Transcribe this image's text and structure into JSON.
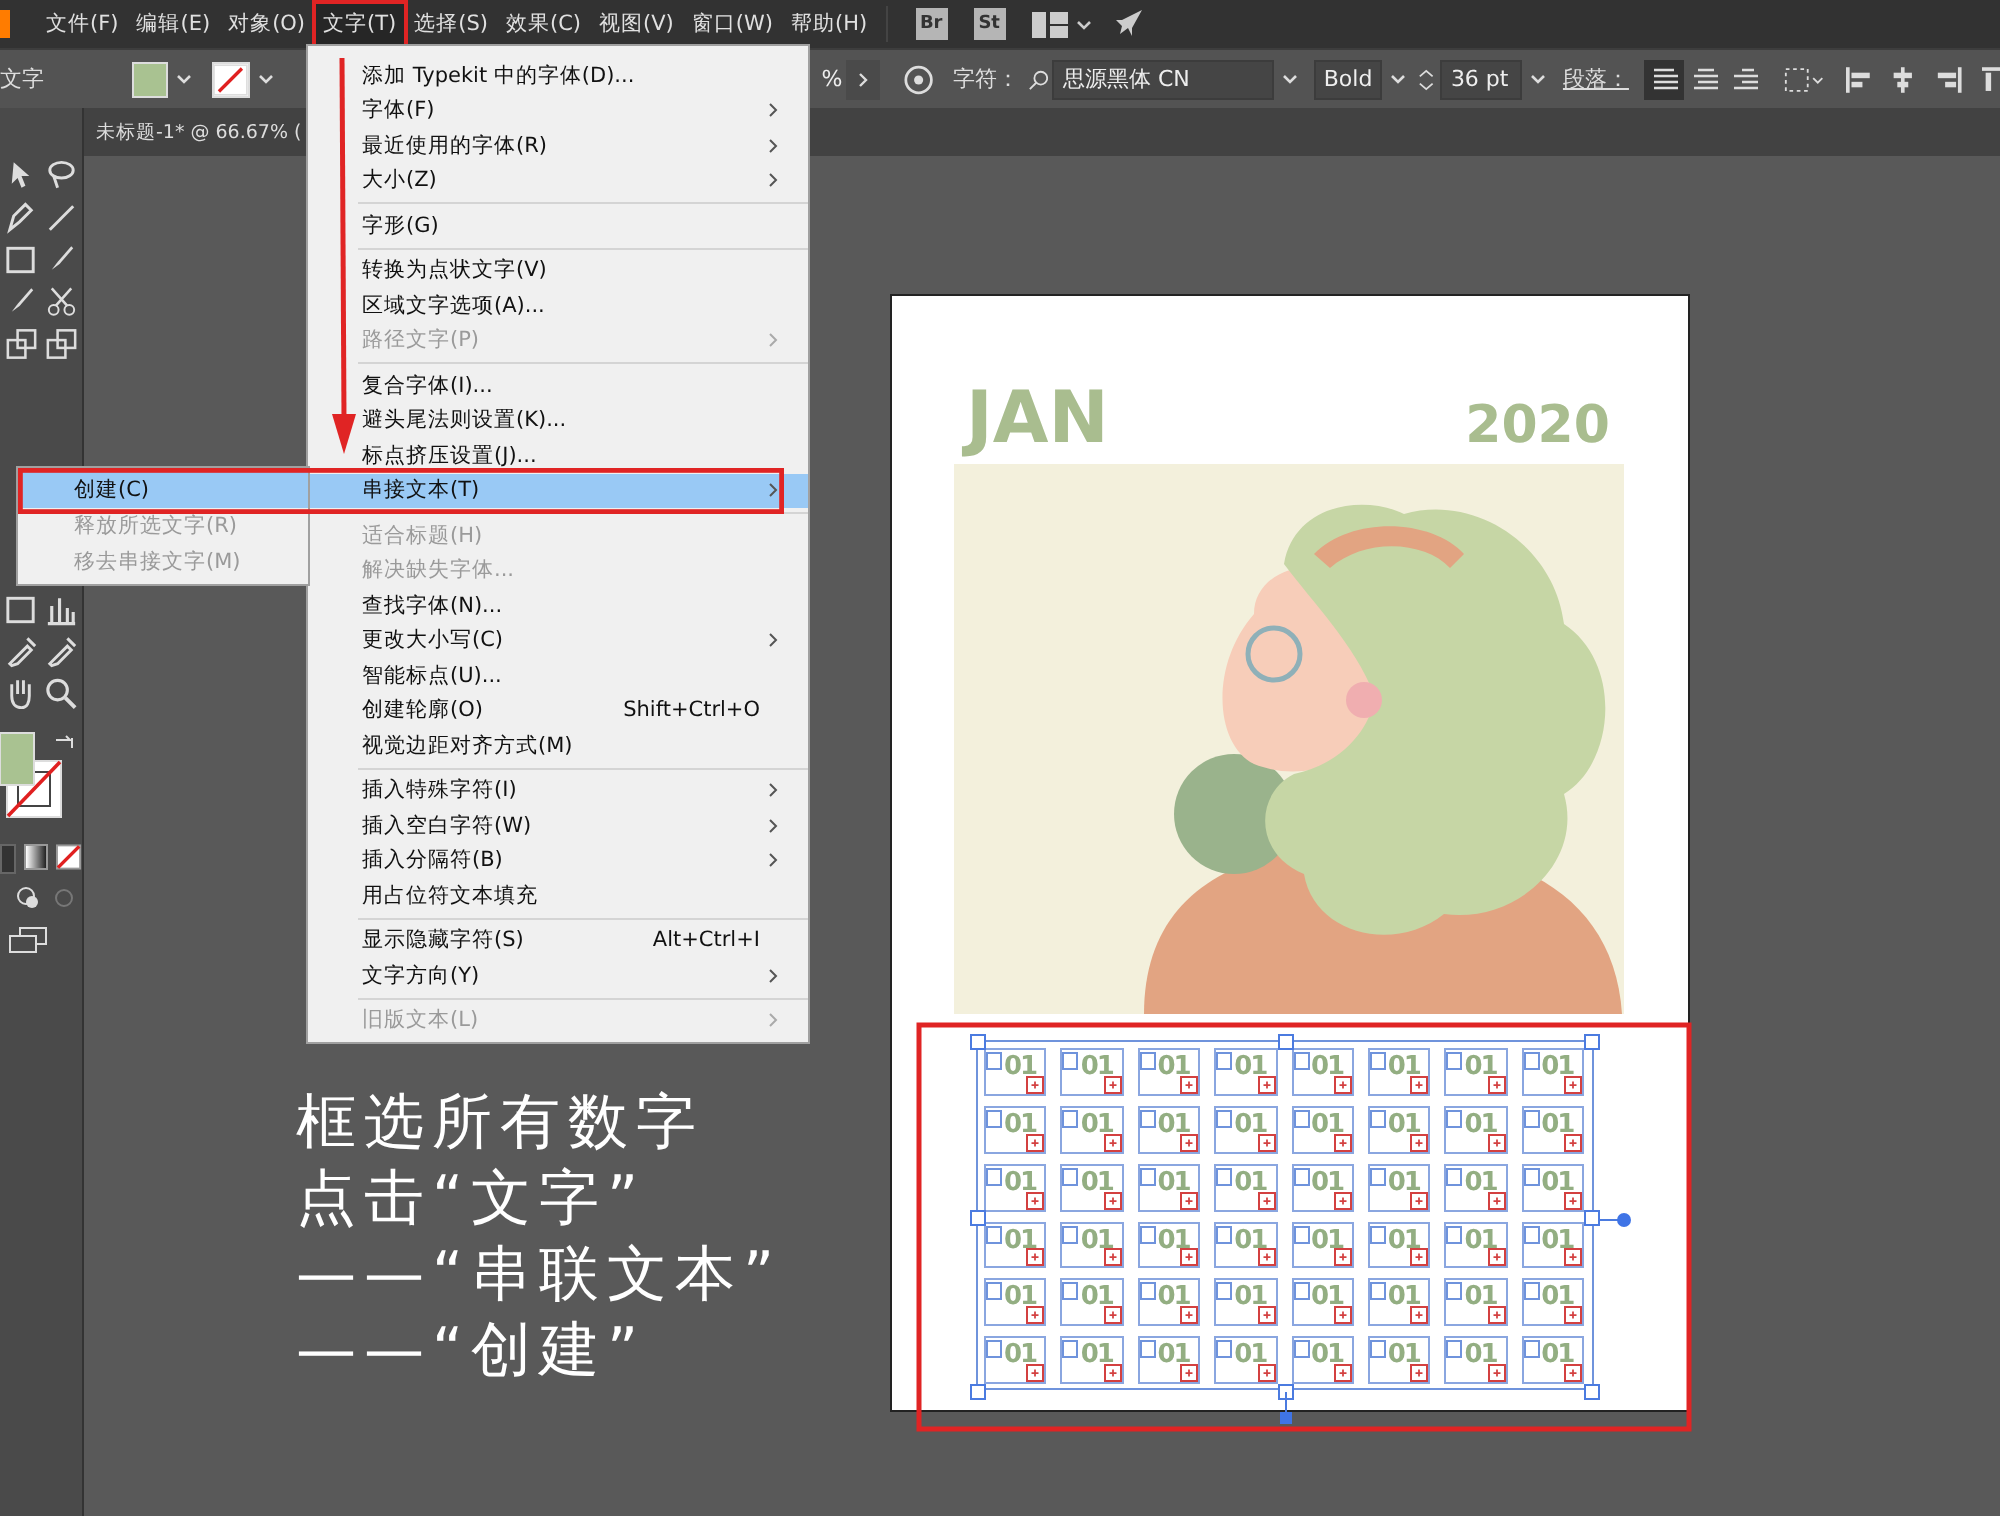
{
  "menubar": {
    "items": [
      {
        "label": "文件(F)",
        "selected": false
      },
      {
        "label": "编辑(E)",
        "selected": false
      },
      {
        "label": "对象(O)",
        "selected": false
      },
      {
        "label": "文字(T)",
        "selected": true
      },
      {
        "label": "选择(S)",
        "selected": false
      },
      {
        "label": "效果(C)",
        "selected": false
      },
      {
        "label": "视图(V)",
        "selected": false
      },
      {
        "label": "窗口(W)",
        "selected": false
      },
      {
        "label": "帮助(H)",
        "selected": false
      }
    ],
    "app_buttons": [
      "Br",
      "St"
    ]
  },
  "control_bar": {
    "tool_label": "文字",
    "field_fragment": "%",
    "char_label": "字符：",
    "font_family": "思源黑体 CN",
    "font_style": "Bold",
    "font_size": "36 pt",
    "para_label": "段落：",
    "align": [
      {
        "selected": true
      },
      {
        "selected": false
      },
      {
        "selected": false
      }
    ]
  },
  "document_tab": {
    "title": "未标题-1* @ 66.67% ("
  },
  "type_menu": {
    "items": [
      {
        "kind": "item",
        "label": "添加 Typekit 中的字体(D)...",
        "disabled": false,
        "submenu": false,
        "selected": false
      },
      {
        "kind": "item",
        "label": "字体(F)",
        "disabled": false,
        "submenu": true,
        "selected": false
      },
      {
        "kind": "item",
        "label": "最近使用的字体(R)",
        "disabled": false,
        "submenu": true,
        "selected": false
      },
      {
        "kind": "item",
        "label": "大小(Z)",
        "disabled": false,
        "submenu": true,
        "selected": false
      },
      {
        "kind": "separator"
      },
      {
        "kind": "item",
        "label": "字形(G)",
        "disabled": false,
        "submenu": false,
        "selected": false
      },
      {
        "kind": "separator"
      },
      {
        "kind": "item",
        "label": "转换为点状文字(V)",
        "disabled": false,
        "submenu": false,
        "selected": false
      },
      {
        "kind": "item",
        "label": "区域文字选项(A)...",
        "disabled": false,
        "submenu": false,
        "selected": false
      },
      {
        "kind": "item",
        "label": "路径文字(P)",
        "disabled": true,
        "submenu": true,
        "selected": false
      },
      {
        "kind": "separator"
      },
      {
        "kind": "item",
        "label": "复合字体(I)...",
        "disabled": false,
        "submenu": false,
        "selected": false
      },
      {
        "kind": "item",
        "label": "避头尾法则设置(K)...",
        "disabled": false,
        "submenu": false,
        "selected": false
      },
      {
        "kind": "item",
        "label": "标点挤压设置(J)...",
        "disabled": false,
        "submenu": false,
        "selected": false
      },
      {
        "kind": "item",
        "label": "串接文本(T)",
        "disabled": false,
        "submenu": true,
        "selected": true
      },
      {
        "kind": "separator"
      },
      {
        "kind": "item",
        "label": "适合标题(H)",
        "disabled": true,
        "submenu": false,
        "selected": false
      },
      {
        "kind": "item",
        "label": "解决缺失字体...",
        "disabled": true,
        "submenu": false,
        "selected": false
      },
      {
        "kind": "item",
        "label": "查找字体(N)...",
        "disabled": false,
        "submenu": false,
        "selected": false
      },
      {
        "kind": "item",
        "label": "更改大小写(C)",
        "disabled": false,
        "submenu": true,
        "selected": false
      },
      {
        "kind": "item",
        "label": "智能标点(U)...",
        "disabled": false,
        "submenu": false,
        "selected": false
      },
      {
        "kind": "item",
        "label": "创建轮廓(O)",
        "shortcut": "Shift+Ctrl+O",
        "disabled": false,
        "submenu": false,
        "selected": false
      },
      {
        "kind": "item",
        "label": "视觉边距对齐方式(M)",
        "disabled": false,
        "submenu": false,
        "selected": false
      },
      {
        "kind": "separator"
      },
      {
        "kind": "item",
        "label": "插入特殊字符(I)",
        "disabled": false,
        "submenu": true,
        "selected": false
      },
      {
        "kind": "item",
        "label": "插入空白字符(W)",
        "disabled": false,
        "submenu": true,
        "selected": false
      },
      {
        "kind": "item",
        "label": "插入分隔符(B)",
        "disabled": false,
        "submenu": true,
        "selected": false
      },
      {
        "kind": "item",
        "label": "用占位符文本填充",
        "disabled": false,
        "submenu": false,
        "selected": false
      },
      {
        "kind": "separator"
      },
      {
        "kind": "item",
        "label": "显示隐藏字符(S)",
        "shortcut": "Alt+Ctrl+I",
        "disabled": false,
        "submenu": false,
        "selected": false
      },
      {
        "kind": "item",
        "label": "文字方向(Y)",
        "disabled": false,
        "submenu": true,
        "selected": false
      },
      {
        "kind": "separator"
      },
      {
        "kind": "item",
        "label": "旧版文本(L)",
        "disabled": true,
        "submenu": true,
        "selected": false
      }
    ]
  },
  "submenu": {
    "items": [
      {
        "label": "创建(C)",
        "disabled": false,
        "selected": true
      },
      {
        "label": "释放所选文字(R)",
        "disabled": true,
        "selected": false
      },
      {
        "label": "移去串接文字(M)",
        "disabled": true,
        "selected": false
      }
    ]
  },
  "artboard": {
    "month": "JAN",
    "year": "2020",
    "text_frames": [
      "01",
      "01",
      "01",
      "01",
      "01",
      "01",
      "01",
      "01",
      "01",
      "01",
      "01",
      "01",
      "01",
      "01",
      "01",
      "01",
      "01",
      "01",
      "01",
      "01",
      "01",
      "01",
      "01",
      "01",
      "01",
      "01",
      "01",
      "01",
      "01",
      "01",
      "01",
      "01",
      "01",
      "01",
      "01",
      "01",
      "01",
      "01",
      "01",
      "01",
      "01",
      "01",
      "01",
      "01",
      "01",
      "01",
      "01",
      "01"
    ]
  },
  "annotation": {
    "lines": [
      "框选所有数字",
      "点击“文字”",
      "——“串联文本”",
      "——“创建”"
    ]
  }
}
